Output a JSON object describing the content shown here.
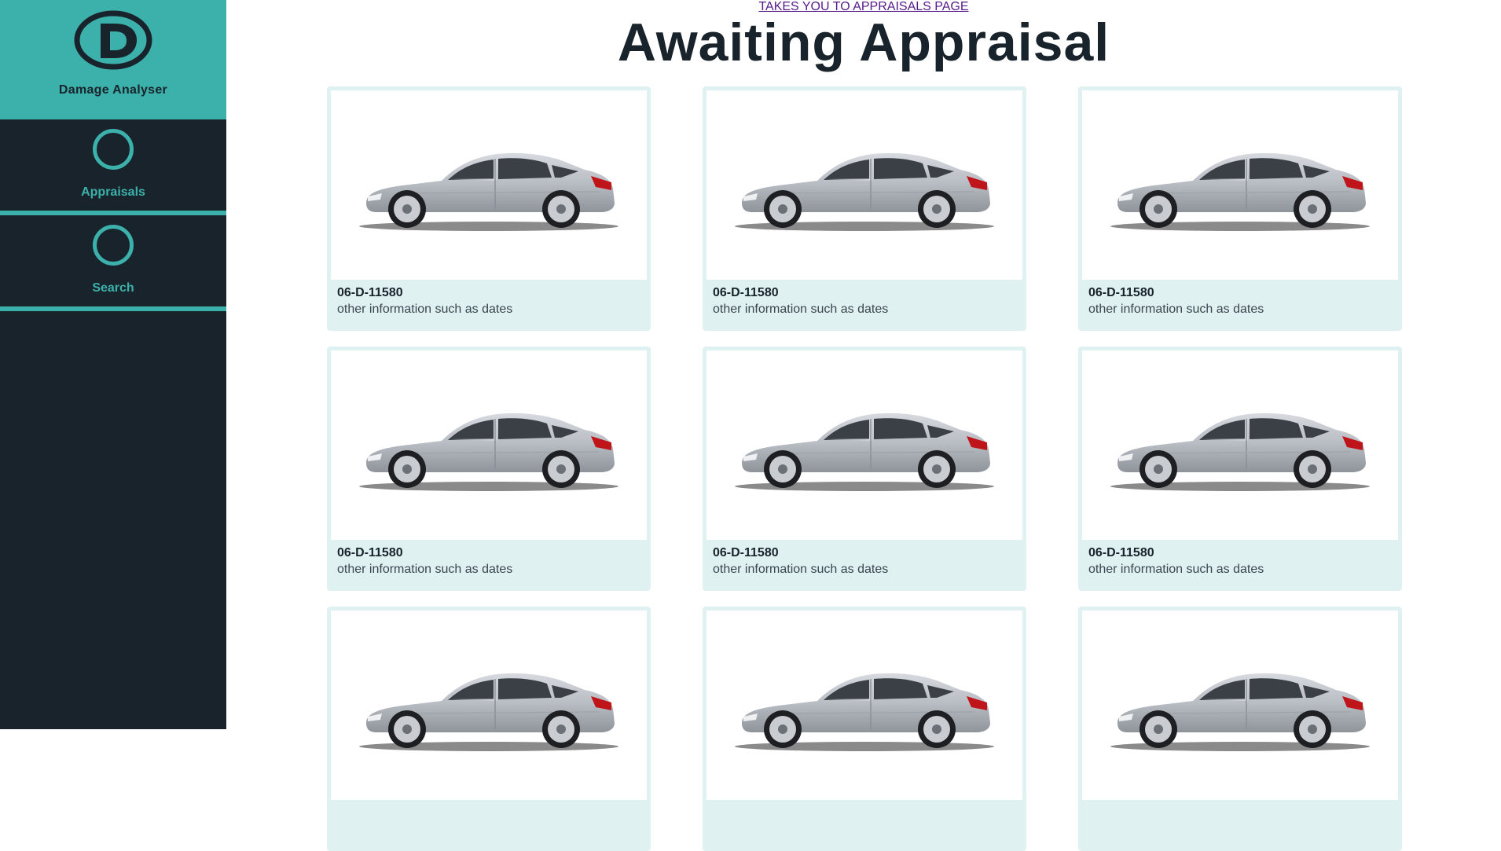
{
  "sidebar": {
    "logo_icon": "d-logo-icon",
    "brand_name": "Damage Analyser",
    "items": [
      {
        "label": "Appraisals",
        "icon": "circle-icon"
      },
      {
        "label": "Search",
        "icon": "circle-icon"
      }
    ]
  },
  "header": {
    "link_text": "TAKES YOU TO APPRAISALS PAGE",
    "title": "Awaiting Appraisal"
  },
  "cards": [
    {
      "title": "06-D-11580",
      "subtitle": "other information such as dates",
      "image": "car-image"
    },
    {
      "title": "06-D-11580",
      "subtitle": "other information such as dates",
      "image": "car-image"
    },
    {
      "title": "06-D-11580",
      "subtitle": "other information such as dates",
      "image": "car-image"
    },
    {
      "title": "06-D-11580",
      "subtitle": "other information such as dates",
      "image": "car-image"
    },
    {
      "title": "06-D-11580",
      "subtitle": "other information such as dates",
      "image": "car-image"
    },
    {
      "title": "06-D-11580",
      "subtitle": "other information such as dates",
      "image": "car-image"
    },
    {
      "title": "",
      "subtitle": "",
      "image": "car-image"
    },
    {
      "title": "",
      "subtitle": "",
      "image": "car-image"
    },
    {
      "title": "",
      "subtitle": "",
      "image": "car-image"
    }
  ],
  "colors": {
    "accent": "#3cb0aa",
    "sidebar_bg": "#18232b",
    "card_bg": "#dff1f0"
  }
}
